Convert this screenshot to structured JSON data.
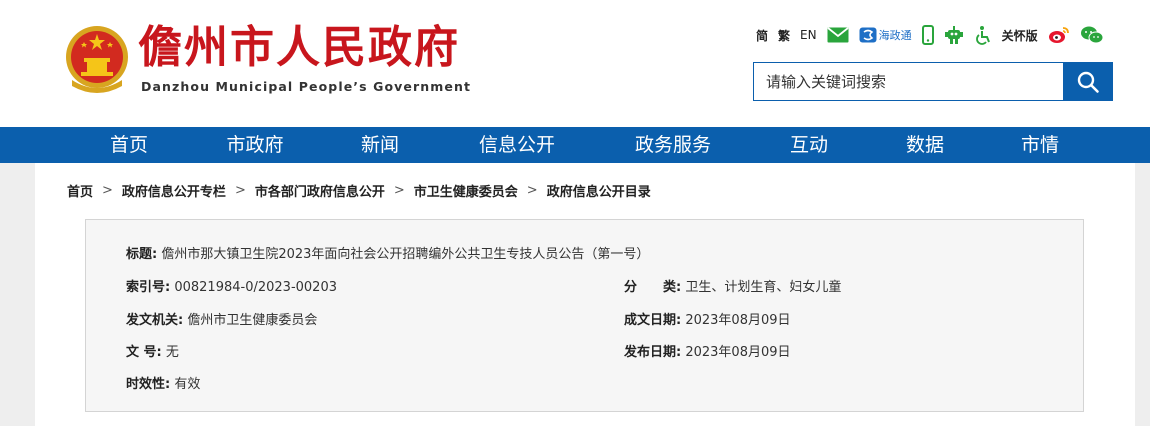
{
  "header": {
    "site_title": "儋州市人民政府",
    "site_subtitle": "Danzhou Municipal People’s Government"
  },
  "toolbar": {
    "simplified": "简",
    "traditional": "繁",
    "english": "EN",
    "mail_icon": "mail-icon",
    "haizhengtong": "海政通",
    "mobile_icon": "mobile-icon",
    "robot_icon": "robot-icon",
    "accessibility_icon": "accessibility-icon",
    "care_mode": "关怀版",
    "weibo_icon": "weibo-icon",
    "wechat_icon": "wechat-icon"
  },
  "search": {
    "placeholder": "请输入关键词搜索"
  },
  "nav": {
    "items": [
      "首页",
      "市政府",
      "新闻",
      "信息公开",
      "政务服务",
      "互动",
      "数据",
      "市情"
    ]
  },
  "breadcrumb": {
    "items": [
      "首页",
      "政府信息公开专栏",
      "市各部门政府信息公开",
      "市卫生健康委员会",
      "政府信息公开目录"
    ],
    "separator": ">"
  },
  "info": {
    "title_label": "标题:",
    "title_value": "儋州市那大镇卫生院2023年面向社会公开招聘编外公共卫生专技人员公告（第一号）",
    "index_label": "索引号:",
    "index_value": "00821984-0/2023-00203",
    "category_label": "分　　类:",
    "category_value": "卫生、计划生育、妇女儿童",
    "issuer_label": "发文机关:",
    "issuer_value": "儋州市卫生健康委员会",
    "created_label": "成文日期:",
    "created_value": "2023年08月09日",
    "docno_label": "文 号:",
    "docno_value": "无",
    "published_label": "发布日期:",
    "published_value": "2023年08月09日",
    "validity_label": "时效性:",
    "validity_value": "有效"
  },
  "colors": {
    "brand_red": "#c8161d",
    "nav_blue": "#0b5fad",
    "background": "#eeeeee"
  }
}
